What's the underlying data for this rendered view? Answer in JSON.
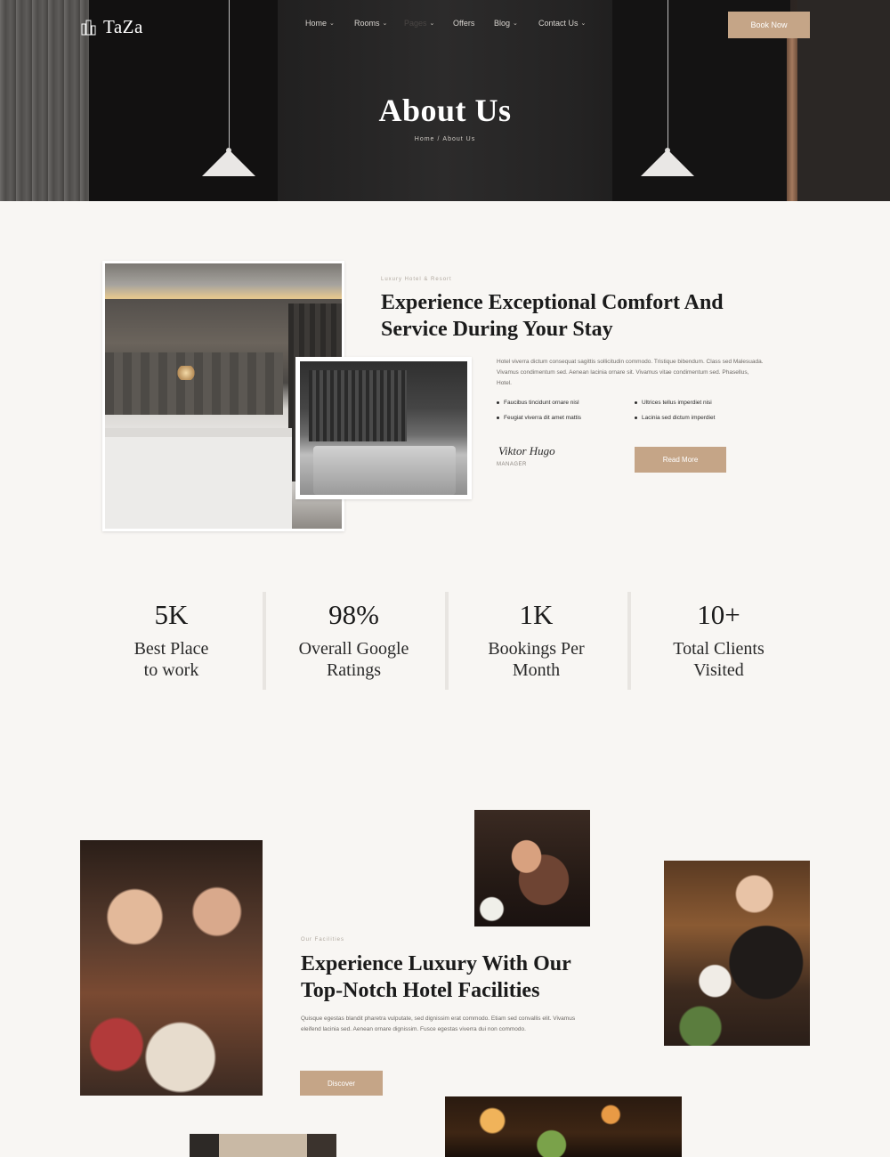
{
  "brand": {
    "name": "TaZa",
    "accent": "#c5a587"
  },
  "nav": [
    {
      "label": "Home"
    },
    {
      "label": "Rooms"
    },
    {
      "label": "Pages"
    },
    {
      "label": "Offers"
    },
    {
      "label": "Blog"
    },
    {
      "label": "Contact Us"
    }
  ],
  "header": {
    "book_label": "Book Now"
  },
  "hero": {
    "title": "About Us",
    "breadcrumb": [
      "Home",
      "About Us"
    ]
  },
  "about": {
    "eyebrow": "Luxury Hotel & Resort",
    "heading": "Experience Exceptional Comfort And Service During Your Stay",
    "body": "Hotel viverra dictum consequat sagittis sollicitudin commodo. Tristique bibendum. Class sed Malesuada. Vivamus condimentum sed. Aenean lacinia ornare sit. Vivamus vitae condimentum sed. Phasellus, Hotel.",
    "features": [
      "Faucibus tincidunt ornare nisl",
      "Ultrices tellus imperdiet nisi",
      "Feugiat viverra dit amet mattis",
      "Lacinia sed dictum imperdiet"
    ],
    "signature_name": "Viktor Hugo",
    "signature_role": "MANAGER",
    "button_label": "Read More"
  },
  "stats": [
    {
      "value": "5K",
      "label": "Best Place to work"
    },
    {
      "value": "98%",
      "label": "Overall Google Ratings"
    },
    {
      "value": "1K",
      "label": "Bookings Per Month"
    },
    {
      "value": "10+",
      "label": "Total Clients Visited"
    }
  ],
  "facilities": {
    "eyebrow": "Our Facilities",
    "heading": "Experience Luxury With Our Top-Notch Hotel Facilities",
    "body": "Quisque egestas blandit pharetra vulputate, sed dignissim erat commodo. Etiam sed convallis elit. Vivamus eleifend lacinia sed. Aenean ornare dignissim. Fusce egestas viverra dui non commodo.",
    "button_label": "Discover"
  }
}
